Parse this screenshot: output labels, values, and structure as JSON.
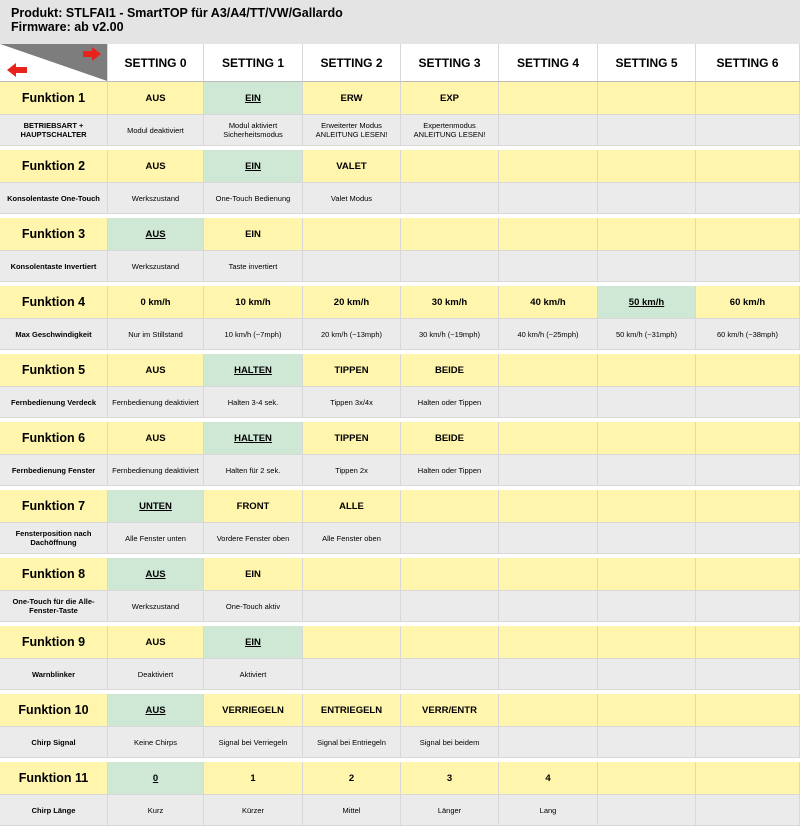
{
  "header": {
    "title": "Produkt: STLFAI1 - SmartTOP für A3/A4/TT/VW/Gallardo",
    "firmware": "Firmware: ab v2.00"
  },
  "colors": {
    "accent_yellow": "#fff5ad",
    "selected_green": "#cfe8d6",
    "desc_gray": "#ebebeb",
    "arrow_red": "#e8231b"
  },
  "corner_icons": [
    "arrow-left-icon",
    "arrow-right-icon"
  ],
  "columns": [
    "SETTING 0",
    "SETTING 1",
    "SETTING 2",
    "SETTING 3",
    "SETTING 4",
    "SETTING 5",
    "SETTING 6"
  ],
  "functions": [
    {
      "name": "Funktion 1",
      "desc": "BETRIEBSART + HAUPTSCHALTER",
      "values": [
        "AUS",
        "EIN",
        "ERW",
        "EXP",
        "",
        "",
        ""
      ],
      "descs": [
        "Modul deaktiviert",
        "Modul aktiviert Sicherheitsmodus",
        "Erweiterter Modus ANLEITUNG LESEN!",
        "Expertenmodus ANLEITUNG LESEN!",
        "",
        "",
        ""
      ],
      "selected": 1
    },
    {
      "name": "Funktion 2",
      "desc": "Konsolentaste One-Touch",
      "values": [
        "AUS",
        "EIN",
        "VALET",
        "",
        "",
        "",
        ""
      ],
      "descs": [
        "Werkszustand",
        "One-Touch Bedienung",
        "Valet Modus",
        "",
        "",
        "",
        ""
      ],
      "selected": 1
    },
    {
      "name": "Funktion 3",
      "desc": "Konsolentaste Invertiert",
      "values": [
        "AUS",
        "EIN",
        "",
        "",
        "",
        "",
        ""
      ],
      "descs": [
        "Werkszustand",
        "Taste invertiert",
        "",
        "",
        "",
        "",
        ""
      ],
      "selected": 0
    },
    {
      "name": "Funktion 4",
      "desc": "Max Geschwindigkeit",
      "values": [
        "0 km/h",
        "10 km/h",
        "20 km/h",
        "30 km/h",
        "40 km/h",
        "50 km/h",
        "60 km/h"
      ],
      "descs": [
        "Nur im Stillstand",
        "10 km/h (~7mph)",
        "20 km/h (~13mph)",
        "30 km/h (~19mph)",
        "40 km/h (~25mph)",
        "50 km/h (~31mph)",
        "60 km/h (~38mph)"
      ],
      "selected": 5
    },
    {
      "name": "Funktion 5",
      "desc": "Fernbedienung Verdeck",
      "values": [
        "AUS",
        "HALTEN",
        "TIPPEN",
        "BEIDE",
        "",
        "",
        ""
      ],
      "descs": [
        "Fernbedienung deaktiviert",
        "Halten 3-4 sek.",
        "Tippen 3x/4x",
        "Halten oder Tippen",
        "",
        "",
        ""
      ],
      "selected": 1
    },
    {
      "name": "Funktion 6",
      "desc": "Fernbedienung Fenster",
      "values": [
        "AUS",
        "HALTEN",
        "TIPPEN",
        "BEIDE",
        "",
        "",
        ""
      ],
      "descs": [
        "Fernbedienung deaktiviert",
        "Halten für 2 sek.",
        "Tippen 2x",
        "Halten oder Tippen",
        "",
        "",
        ""
      ],
      "selected": 1
    },
    {
      "name": "Funktion 7",
      "desc": "Fensterposition nach Dachöffnung",
      "values": [
        "UNTEN",
        "FRONT",
        "ALLE",
        "",
        "",
        "",
        ""
      ],
      "descs": [
        "Alle Fenster unten",
        "Vordere Fenster oben",
        "Alle Fenster oben",
        "",
        "",
        "",
        ""
      ],
      "selected": 0
    },
    {
      "name": "Funktion 8",
      "desc": "One-Touch für die Alle-Fenster-Taste",
      "values": [
        "AUS",
        "EIN",
        "",
        "",
        "",
        "",
        ""
      ],
      "descs": [
        "Werkszustand",
        "One-Touch aktiv",
        "",
        "",
        "",
        "",
        ""
      ],
      "selected": 0
    },
    {
      "name": "Funktion 9",
      "desc": "Warnblinker",
      "values": [
        "AUS",
        "EIN",
        "",
        "",
        "",
        "",
        ""
      ],
      "descs": [
        "Deaktiviert",
        "Aktiviert",
        "",
        "",
        "",
        "",
        ""
      ],
      "selected": 1
    },
    {
      "name": "Funktion 10",
      "desc": "Chirp Signal",
      "values": [
        "AUS",
        "VERRIEGELN",
        "ENTRIEGELN",
        "VERR/ENTR",
        "",
        "",
        ""
      ],
      "descs": [
        "Keine Chirps",
        "Signal bei Verriegeln",
        "Signal bei Entriegeln",
        "Signal bei beidem",
        "",
        "",
        ""
      ],
      "selected": 0
    },
    {
      "name": "Funktion 11",
      "desc": "Chirp Länge",
      "values": [
        "0",
        "1",
        "2",
        "3",
        "4",
        "",
        ""
      ],
      "descs": [
        "Kurz",
        "Kürzer",
        "Mittel",
        "Länger",
        "Lang",
        "",
        ""
      ],
      "selected": 0
    }
  ]
}
